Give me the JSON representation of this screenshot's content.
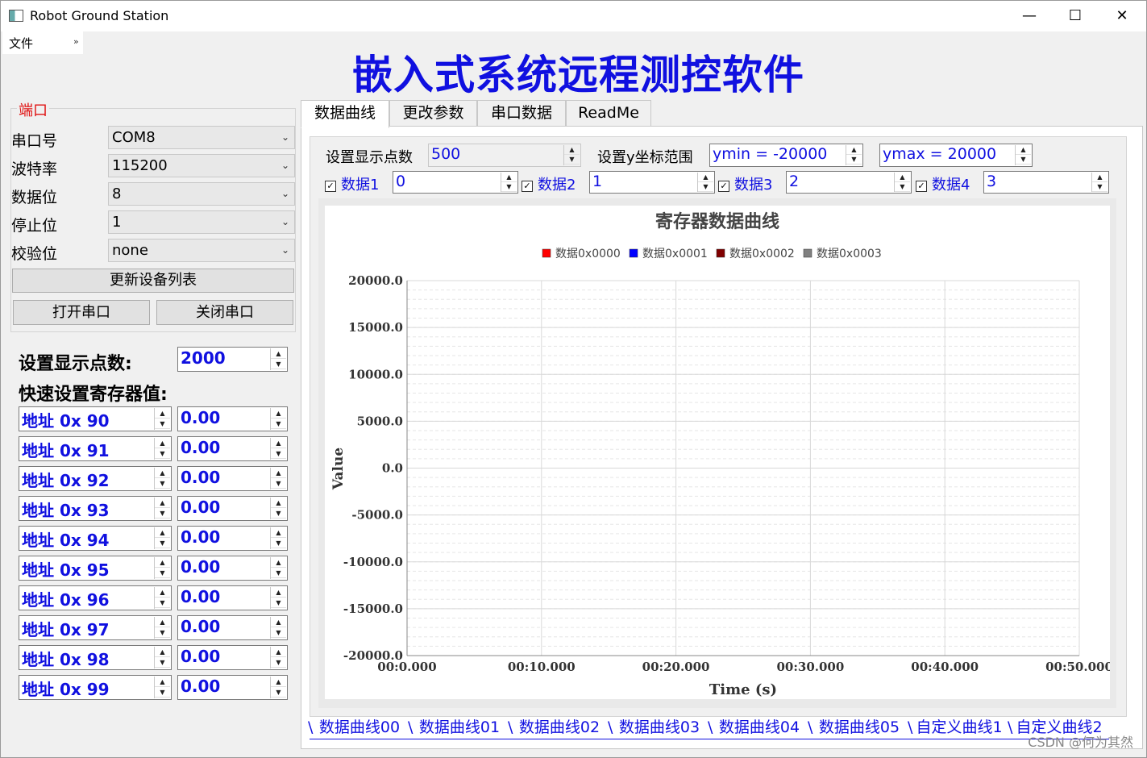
{
  "window": {
    "title": "Robot Ground Station",
    "minimize_glyph": "—",
    "maximize_glyph": "☐",
    "close_glyph": "✕"
  },
  "menu": {
    "file": "文件",
    "more": "»"
  },
  "banner": "嵌入式系统远程测控软件",
  "port": {
    "group_title": "端口",
    "fields": [
      {
        "label": "串口号",
        "value": "COM8"
      },
      {
        "label": "波特率",
        "value": "115200"
      },
      {
        "label": "数据位",
        "value": "8"
      },
      {
        "label": "停止位",
        "value": "1"
      },
      {
        "label": "校验位",
        "value": "none"
      }
    ],
    "refresh_button": "更新设备列表",
    "open_button": "打开串口",
    "close_button": "关闭串口"
  },
  "quick": {
    "points_label": "设置显示点数:",
    "points_value": "2000",
    "registers_label": "快速设置寄存器值:",
    "registers": [
      {
        "address": "地址 0x 90",
        "value": "0.00"
      },
      {
        "address": "地址 0x 91",
        "value": "0.00"
      },
      {
        "address": "地址 0x 92",
        "value": "0.00"
      },
      {
        "address": "地址 0x 93",
        "value": "0.00"
      },
      {
        "address": "地址 0x 94",
        "value": "0.00"
      },
      {
        "address": "地址 0x 95",
        "value": "0.00"
      },
      {
        "address": "地址 0x 96",
        "value": "0.00"
      },
      {
        "address": "地址 0x 97",
        "value": "0.00"
      },
      {
        "address": "地址 0x 98",
        "value": "0.00"
      },
      {
        "address": "地址 0x 99",
        "value": "0.00"
      }
    ]
  },
  "tabs": [
    "数据曲线",
    "更改参数",
    "串口数据",
    "ReadMe"
  ],
  "controls": {
    "points_label": "设置显示点数",
    "points_value": "500",
    "yrange_label": "设置y坐标范围",
    "ymin": "ymin = -20000",
    "ymax": "ymax = 20000",
    "channels": [
      {
        "label": "数据1",
        "value": "0",
        "checked": true
      },
      {
        "label": "数据2",
        "value": "1",
        "checked": true
      },
      {
        "label": "数据3",
        "value": "2",
        "checked": true
      },
      {
        "label": "数据4",
        "value": "3",
        "checked": true
      }
    ]
  },
  "chart_data": {
    "type": "line",
    "title": "寄存器数据曲线",
    "xlabel": "Time (s)",
    "ylabel": "Value",
    "ylim": [
      -20000,
      20000
    ],
    "yticks": [
      "20000.0",
      "15000.0",
      "10000.0",
      "5000.0",
      "0.0",
      "-5000.0",
      "-10000.0",
      "-15000.0",
      "-20000.0"
    ],
    "xticks": [
      "00:0.000",
      "00:10.000",
      "00:20.000",
      "00:30.000",
      "00:40.000",
      "00:50.000"
    ],
    "grid": true,
    "legend_position": "top-center",
    "series": [
      {
        "name": "数据0x0000",
        "color": "#ff0000",
        "values": []
      },
      {
        "name": "数据0x0001",
        "color": "#0000ff",
        "values": []
      },
      {
        "name": "数据0x0002",
        "color": "#800000",
        "values": []
      },
      {
        "name": "数据0x0003",
        "color": "#808080",
        "values": []
      }
    ]
  },
  "bottom_tabs": [
    "数据曲线00",
    "数据曲线01",
    "数据曲线02",
    "数据曲线03",
    "数据曲线04",
    "数据曲线05",
    "自定义曲线1",
    "自定义曲线2"
  ],
  "watermark": "CSDN @何为其然"
}
